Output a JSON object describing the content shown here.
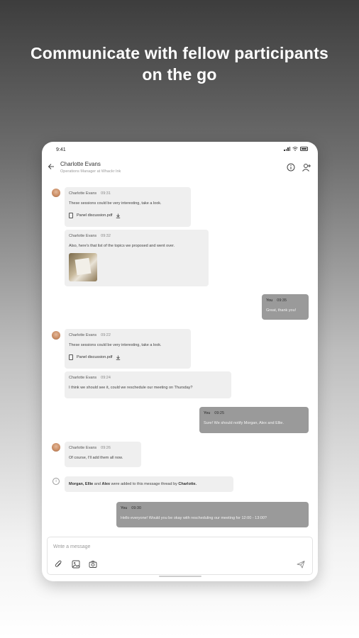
{
  "headline": {
    "line1": "Communicate with fellow participants",
    "line2": "on the go"
  },
  "status_bar": {
    "time": "9:41"
  },
  "chat_header": {
    "name": "Charlotte Evans",
    "role": "Operations Manager at Whackr Ink",
    "icons": [
      "arrow-back-icon",
      "info-icon",
      "add-person-icon"
    ]
  },
  "messages": [
    {
      "sender": "Charlotte Evans",
      "time": "09:31",
      "text": "These sessions could be very interesting, take a look.",
      "attachment": "Panel discussion.pdf"
    },
    {
      "sender": "Charlotte Evans",
      "time": "09:32",
      "text": "Also, here's that list of the topics we proposed and went over."
    },
    {
      "sender": "You",
      "time": "09:35",
      "text": "Great, thank you!"
    },
    {
      "sender": "Charlotte Evans",
      "time": "09:22",
      "text": "These sessions could be very interesting, take a look.",
      "attachment": "Panel discussion.pdf"
    },
    {
      "sender": "Charlotte Evans",
      "time": "09:24",
      "text": "I think we should see it, could we reschedule our meeting on Thursday?"
    },
    {
      "sender": "You",
      "time": "09:25",
      "text": "Sure! We should notify Morgan, Alex and Ellie."
    },
    {
      "sender": "Charlotte Evans",
      "time": "09:26",
      "text": "Of course, I'll add them all now."
    },
    {
      "sender": "You",
      "time": "09:30",
      "text": "Hello everyone! Would you be okay with rescheduling our meeting for 12:00 - 13:00?"
    }
  ],
  "system_message": {
    "pre": "Morgan, Ellie",
    "and1": " and ",
    "name3": "Alex",
    "mid": " were added to this message thread by ",
    "by": "Charlotte."
  },
  "composer": {
    "placeholder": "Write a message",
    "icons": [
      "attachment-icon",
      "image-icon",
      "camera-icon",
      "send-icon"
    ]
  }
}
